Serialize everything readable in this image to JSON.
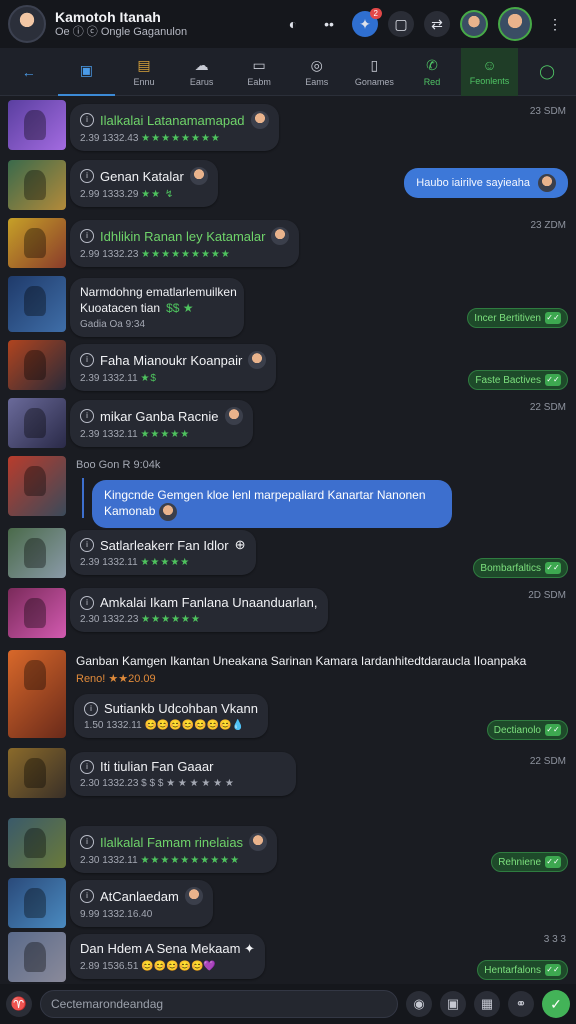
{
  "header": {
    "title": "Kamotoh Itanah",
    "subtitle": "Oe ⓘ ⓒ Ongle Gaganulon",
    "badge_count": "2"
  },
  "tabs": [
    {
      "label": "",
      "icon": "back-arrow-icon"
    },
    {
      "label": "",
      "icon": "window-icon"
    },
    {
      "label": "Ennu",
      "icon": "folder-icon"
    },
    {
      "label": "Earus",
      "icon": "cloud-icon"
    },
    {
      "label": "Eabm",
      "icon": "camera-icon"
    },
    {
      "label": "Eams",
      "icon": "gamepad-icon"
    },
    {
      "label": "Gonames",
      "icon": "document-icon"
    },
    {
      "label": "Red",
      "icon": "phone-icon"
    },
    {
      "label": "Feonlents",
      "icon": "people-icon"
    },
    {
      "label": "",
      "icon": "shield-icon"
    }
  ],
  "rows": [
    {
      "line1": "Ilalkalai Latanamamapad",
      "line2": "2.39 1332.43",
      "stars": "★★★★★★★★",
      "time": "23 SDM",
      "colors": [
        "#5a3fa0",
        "#a36be0"
      ]
    },
    {
      "line1": "Genan Katalar",
      "line2": "2.99 1333.29",
      "stars": "★★ ↯",
      "pill": "Haubo iairilve sayieaha",
      "colors": [
        "#3a6a4c",
        "#b38a3a"
      ]
    },
    {
      "line1": "Idhlikin Ranan ley Katamalar",
      "line2": "2.99 1332.23",
      "stars": "★★★★★★★★★",
      "time": "23 ZDM",
      "colors": [
        "#c6a028",
        "#8a3c2a"
      ]
    },
    {
      "line1": "Narmdohng ematlarlemuilken",
      "line1b": "Kuoatacen tian",
      "line2": "Gadia Oa 9:34",
      "stars": "$$ ★",
      "gtime": "Incer Bertitiven",
      "colors": [
        "#1f3a6a",
        "#3f6ea8"
      ]
    },
    {
      "line1": "Faha Mianoukr Koanpair",
      "line2": "2.39 1332.11",
      "stars": "★$",
      "gtime": "Faste Bactives",
      "colors": [
        "#b0441f",
        "#2a2a38"
      ]
    },
    {
      "line1": "mikar Ganba Racnie",
      "line2": "2.39 1332.11",
      "stars": "★★★★★",
      "time": "22 SDM",
      "colors": [
        "#6a6a9a",
        "#2a2a48"
      ]
    },
    {
      "line1": "Boo Gon  R 9:04k",
      "big": "Kingcnde Gemgen kloe lenl marpepaliard Kanartar Nanonen Kamonab",
      "colors": [
        "#b83c2c",
        "#3a4a5a"
      ]
    },
    {
      "line1": "Satlarleakerr Fan Idlor",
      "line2": "2.39 1332.11",
      "stars": "★★★★★",
      "gtime": "Bombarfaltics",
      "colors": [
        "#4a6a4a",
        "#8a9aa8"
      ]
    },
    {
      "line1": "Amkalai Ikam Fanlana Unaanduarlan,",
      "line2": "2.30 1332.23",
      "stars": "★★★★★★",
      "time": "2D SDM",
      "colors": [
        "#7a2a5a",
        "#d25ab0"
      ]
    },
    {
      "line1": "Ganban Kamgen Ikantan Uneakana Sarinan Kamara Iardanhitedtdaraucla IIoanpaka",
      "line2": "Reno! ★★20.09",
      "colors": [
        "#d8682a",
        "#6a2a1a"
      ]
    },
    {
      "line1": "Sutiankb Udcohban Vkann",
      "line2": "1.50 1332.11",
      "gtime": "Dectianolo",
      "colors": [
        "#d8682a",
        "#6a2a1a"
      ]
    },
    {
      "line1": "Iti tiulian Fan Gaaar",
      "line2": "2.30 1332.23",
      "stars": "$ $ $ ★ ★ ★ ★ ★ ★",
      "time": "22 SDM",
      "colors": [
        "#8a6a2a",
        "#3a3028"
      ]
    },
    {
      "line1": "Ilalkalal Famam rinelaias",
      "line2": "2.30 1332.11",
      "stars": "★★★★★★★★★★",
      "gtime": "Rehniene",
      "colors": [
        "#3a5a6a",
        "#6a7a3a"
      ]
    },
    {
      "line1": "AtCanlaedam",
      "line2": "9.99 1332.16.40",
      "colors": [
        "#2a4a7a",
        "#4a8ac0"
      ]
    },
    {
      "line1": "Dan Hdem A Sena Mekaam ✦",
      "line2": "2.89 1536.51",
      "gtime": "Hentarfalons",
      "time": "3 3 3",
      "colors": [
        "#5a6a8a",
        "#8a8a9a"
      ]
    }
  ],
  "composer": {
    "placeholder": "Cectemarondeandag"
  }
}
